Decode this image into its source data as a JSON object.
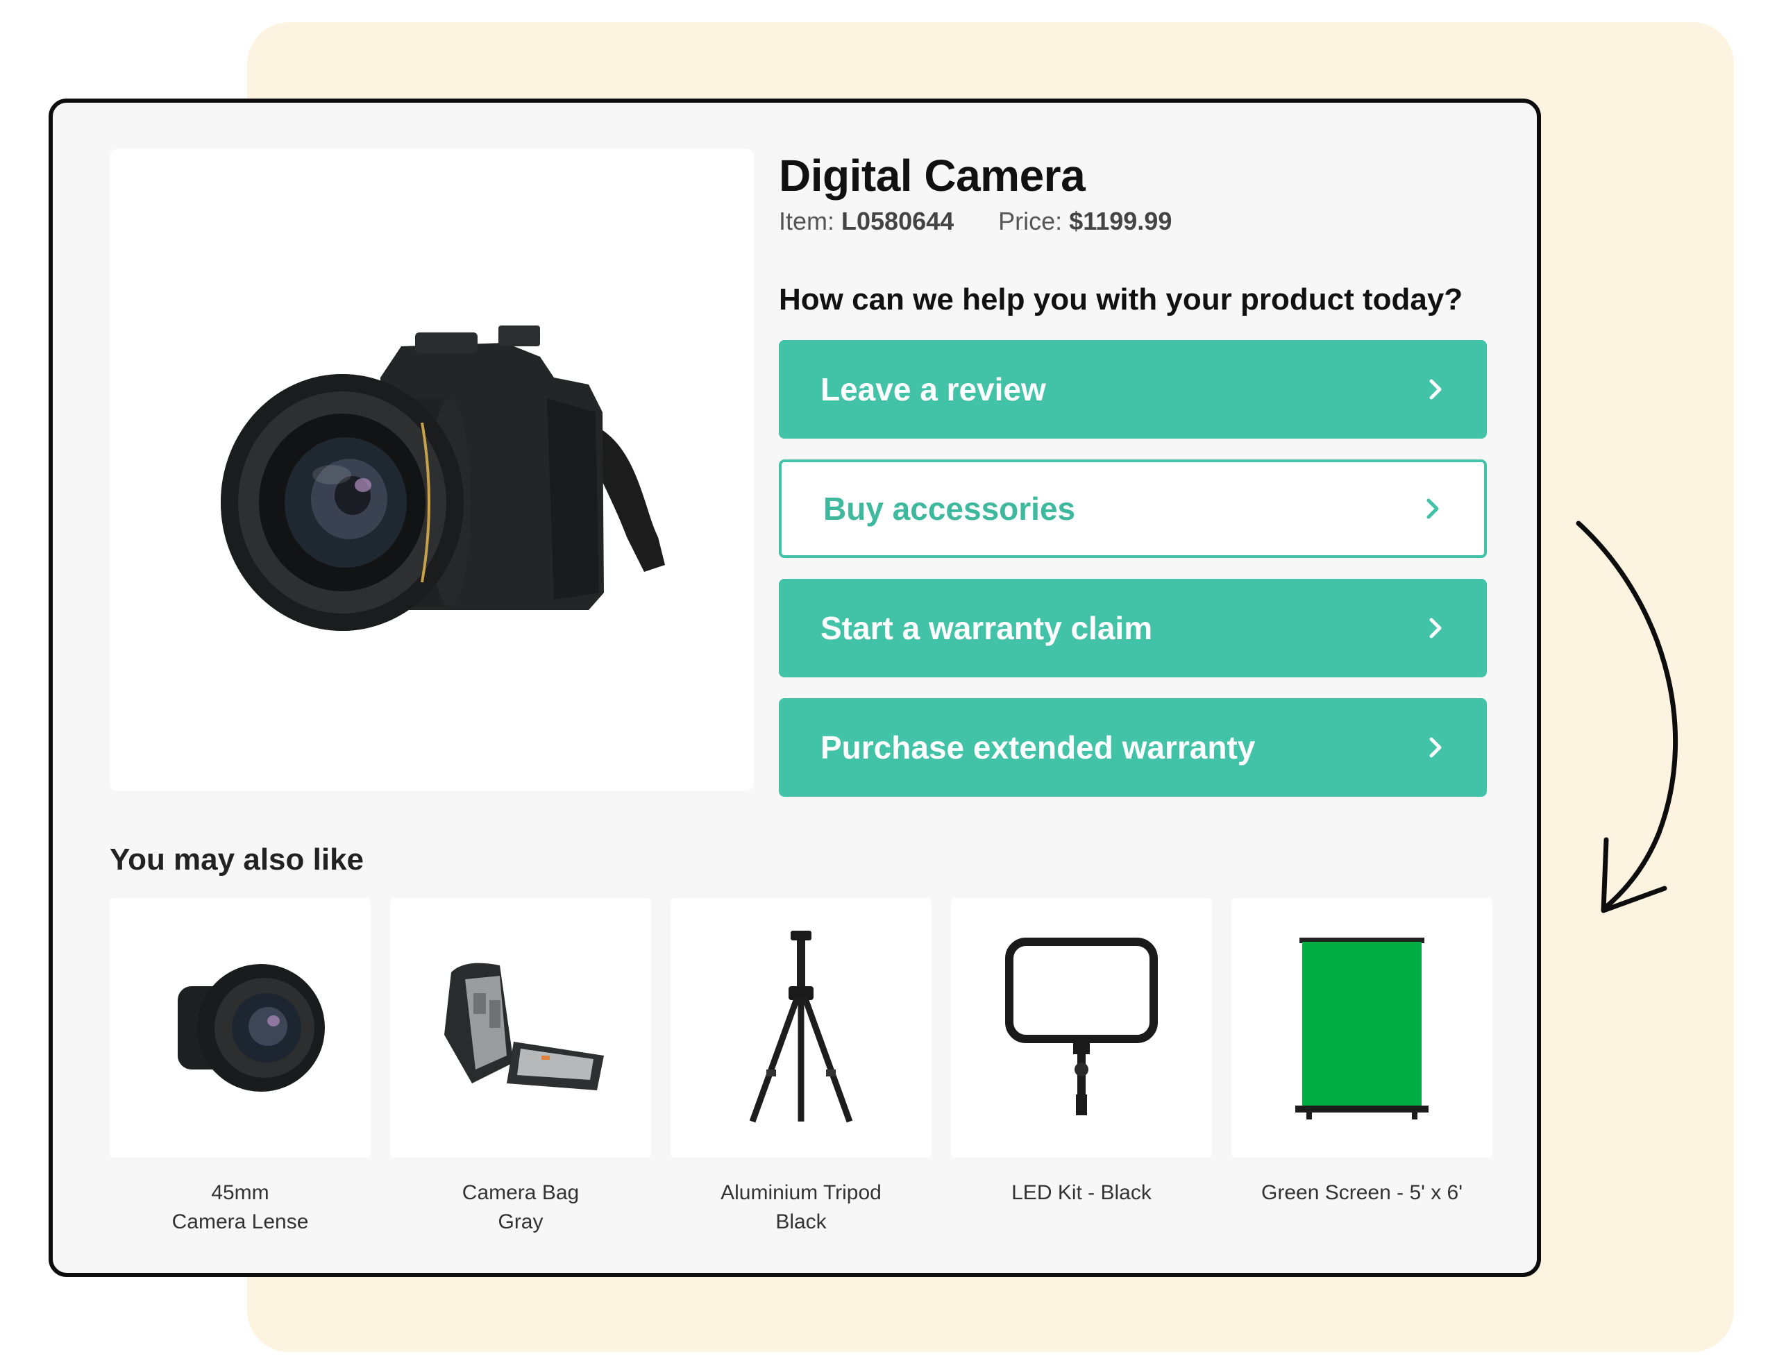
{
  "product": {
    "title": "Digital Camera",
    "item_label": "Item:",
    "item_value": "L0580644",
    "price_label": "Price:",
    "price_value": "$1199.99",
    "image_icon": "camera-photo"
  },
  "help": {
    "question": "How can we help you with your product today?",
    "actions": [
      {
        "label": "Leave a review",
        "style": "filled",
        "icon": "chevron-right-icon"
      },
      {
        "label": "Buy accessories",
        "style": "outline",
        "icon": "chevron-right-icon"
      },
      {
        "label": "Start a warranty claim",
        "style": "filled",
        "icon": "chevron-right-icon"
      },
      {
        "label": "Purchase extended warranty",
        "style": "filled",
        "icon": "chevron-right-icon"
      }
    ]
  },
  "recommendations": {
    "heading": "You may also like",
    "items": [
      {
        "line1": "45mm",
        "line2": "Camera Lense",
        "icon": "camera-lens"
      },
      {
        "line1": "Camera Bag",
        "line2": "Gray",
        "icon": "camera-bag"
      },
      {
        "line1": "Aluminium Tripod",
        "line2": "Black",
        "icon": "tripod"
      },
      {
        "line1": "LED Kit - Black",
        "line2": "",
        "icon": "led-panel"
      },
      {
        "line1": "Green Screen - 5' x 6'",
        "line2": "",
        "icon": "green-screen"
      }
    ]
  },
  "colors": {
    "accent": "#42c2a7",
    "background_panel": "#fdf3e1",
    "frame_border": "#0d0d0d"
  }
}
